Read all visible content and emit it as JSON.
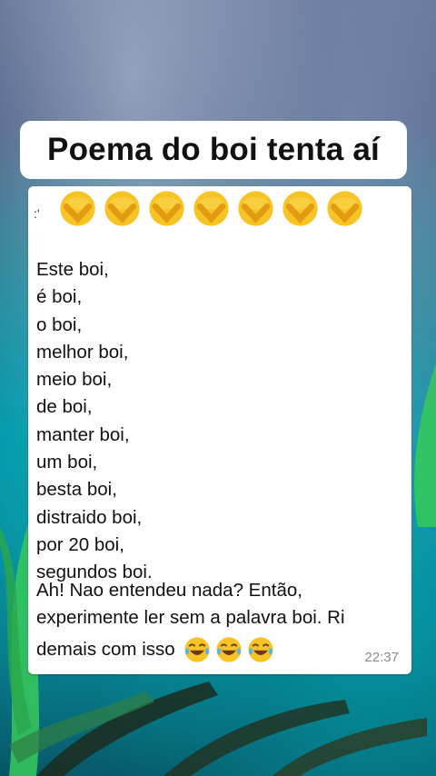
{
  "title": "Poema do boi tenta aí",
  "message": {
    "leading": ":'",
    "emojis": [
      "face-with-hand-over-mouth-icon",
      "face-with-hand-over-mouth-icon",
      "face-with-hand-over-mouth-icon",
      "face-with-hand-over-mouth-icon",
      "face-with-hand-over-mouth-icon",
      "face-with-hand-over-mouth-icon",
      "face-with-hand-over-mouth-icon"
    ],
    "poem_lines": [
      "Este boi,",
      "é boi,",
      "o boi,",
      "melhor boi,",
      "meio boi,",
      "de boi,",
      "manter boi,",
      "um boi,",
      "besta boi,",
      "distraido boi,",
      "por 20 boi,",
      "segundos boi."
    ],
    "note_line_1": "Ah! Nao entendeu nada? Então,",
    "note_line_2": "experimente ler sem a palavra boi. Ri",
    "note_line_3": "demais com isso",
    "trailing_emojis": [
      "face-with-tears-of-joy-icon",
      "face-with-tears-of-joy-icon",
      "face-with-tears-of-joy-icon"
    ],
    "time": "22:37"
  }
}
